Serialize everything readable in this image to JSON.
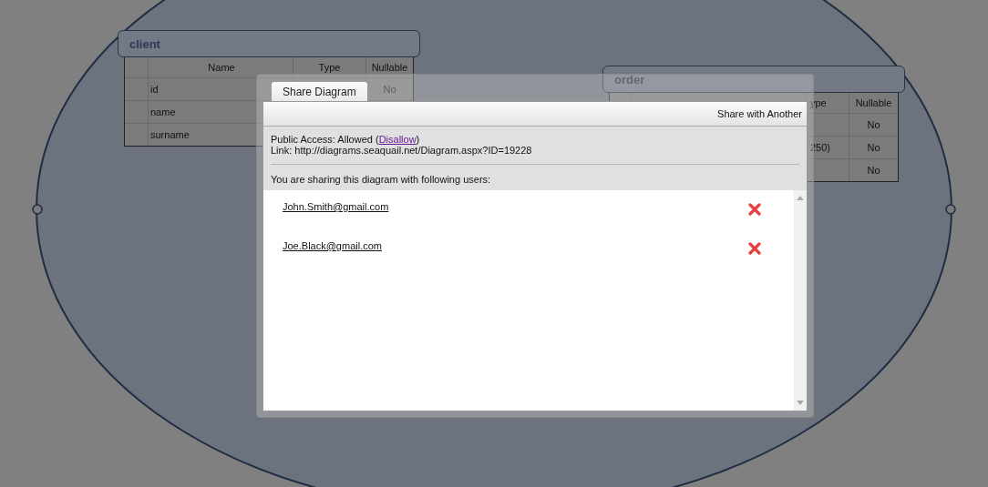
{
  "canvas": {
    "tables": [
      {
        "title": "client",
        "header": {
          "name": "Name",
          "type": "Type",
          "nullable": "Nullable"
        },
        "rows": [
          {
            "name": "id",
            "nullable": "No"
          },
          {
            "name": "name"
          },
          {
            "name": "surname"
          }
        ]
      },
      {
        "title": "order",
        "header": {
          "type": "ype",
          "nullable": "Nullable"
        },
        "rows": [
          {
            "nullable": "No"
          },
          {
            "type": "250)",
            "nullable": "No"
          },
          {
            "nullable": "No"
          }
        ]
      }
    ]
  },
  "dialog": {
    "tabs": [
      {
        "label": "Share Diagram",
        "selected": true
      }
    ],
    "toolbar_button": "Share with Another",
    "public_access": {
      "label": "Public Access: Allowed (",
      "link": "Disallow",
      "after": ")"
    },
    "link_line": "Link: http://diagrams.seaquail.net/Diagram.aspx?ID=19228",
    "sharing_note": "You are sharing this diagram with following users:",
    "users": [
      {
        "email": "John.Smith@gmail.com"
      },
      {
        "email": "Joe.Black@gmail.com"
      }
    ]
  }
}
